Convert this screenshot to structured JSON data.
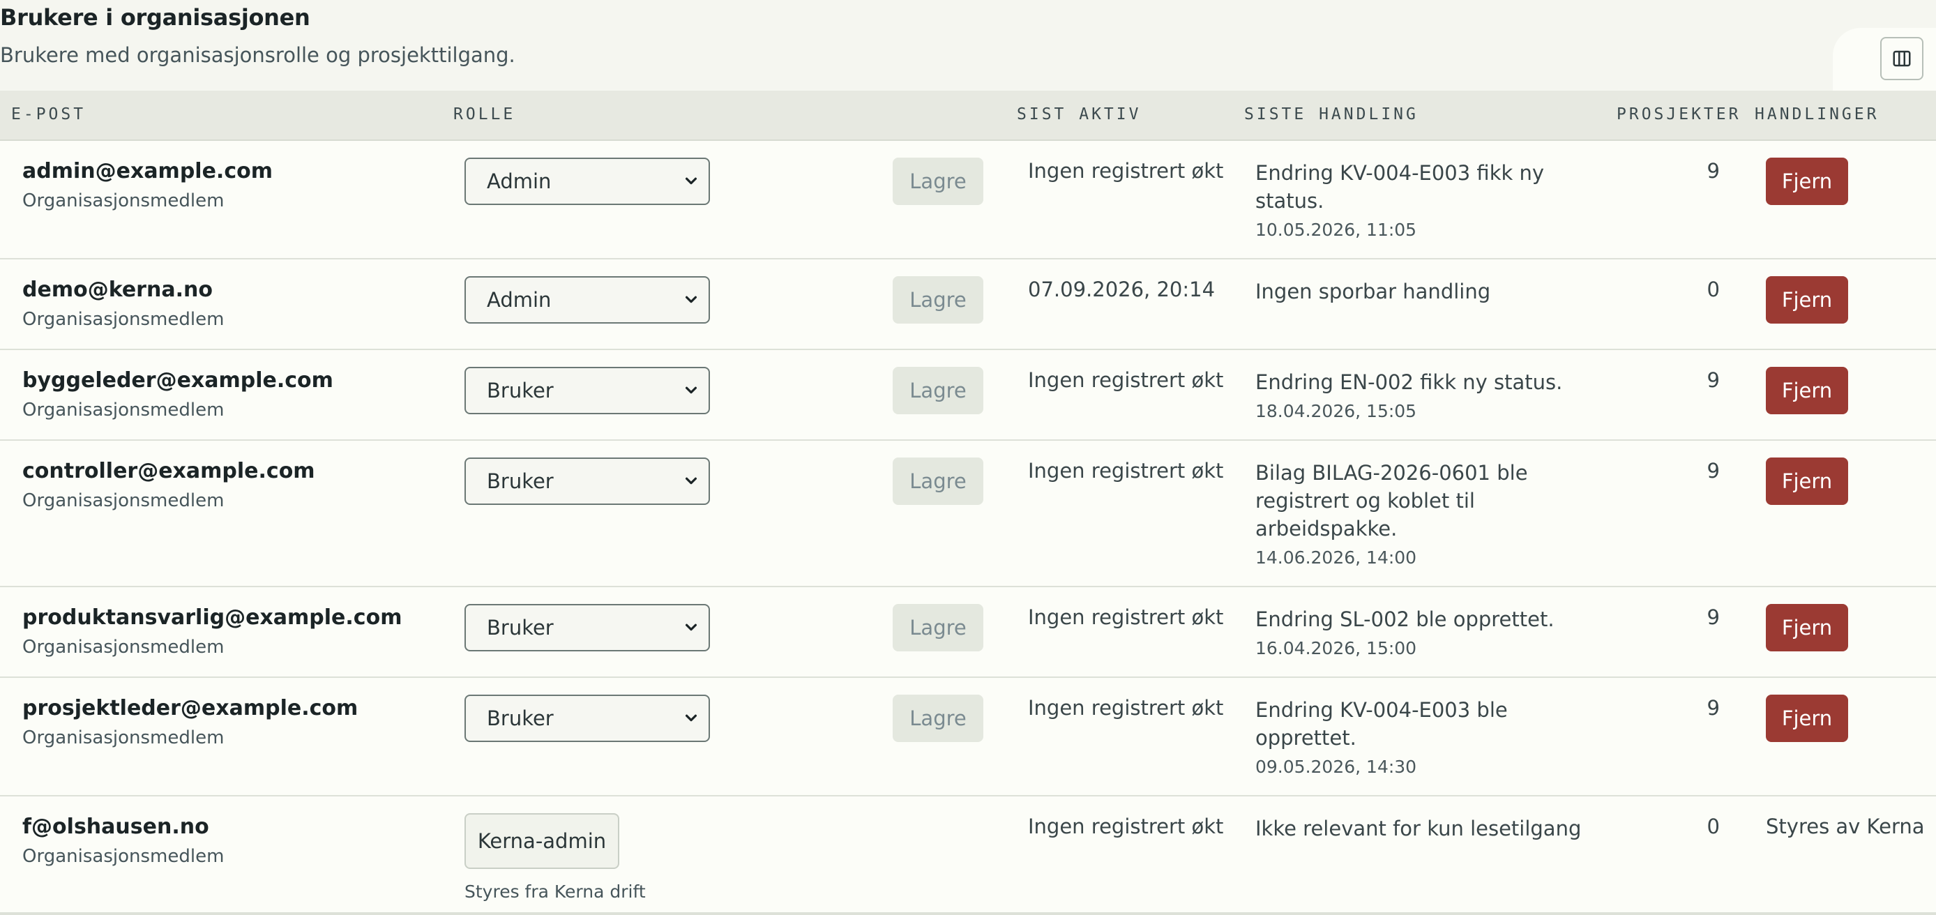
{
  "header": {
    "title": "Brukere i organisasjonen",
    "subtitle": "Brukere med organisasjonsrolle og prosjekttilgang.",
    "columns_icon": "columns-icon"
  },
  "columns": {
    "email": "E-POST",
    "role": "ROLLE",
    "last_active": "SIST AKTIV",
    "last_action": "SISTE HANDLING",
    "projects": "PROSJEKTER",
    "actions": "HANDLINGER"
  },
  "labels": {
    "save": "Lagre",
    "remove": "Fjern"
  },
  "rows": [
    {
      "email": "admin@example.com",
      "member": "Organisasjonsmedlem",
      "role": "Admin",
      "last_active": "Ingen registrert økt",
      "action": "Endring KV-004-E003 fikk ny status.",
      "action_date": "10.05.2026, 11:05",
      "projects": "9"
    },
    {
      "email": "demo@kerna.no",
      "member": "Organisasjonsmedlem",
      "role": "Admin",
      "last_active": "07.09.2026, 20:14",
      "action": "Ingen sporbar handling",
      "action_date": "",
      "projects": "0"
    },
    {
      "email": "byggeleder@example.com",
      "member": "Organisasjonsmedlem",
      "role": "Bruker",
      "last_active": "Ingen registrert økt",
      "action": "Endring EN-002 fikk ny status.",
      "action_date": "18.04.2026, 15:05",
      "projects": "9"
    },
    {
      "email": "controller@example.com",
      "member": "Organisasjonsmedlem",
      "role": "Bruker",
      "last_active": "Ingen registrert økt",
      "action": "Bilag BILAG-2026-0601 ble registrert og koblet til arbeidspakke.",
      "action_date": "14.06.2026, 14:00",
      "projects": "9"
    },
    {
      "email": "produktansvarlig@example.com",
      "member": "Organisasjonsmedlem",
      "role": "Bruker",
      "last_active": "Ingen registrert økt",
      "action": "Endring SL-002 ble opprettet.",
      "action_date": "16.04.2026, 15:00",
      "projects": "9"
    },
    {
      "email": "prosjektleder@example.com",
      "member": "Organisasjonsmedlem",
      "role": "Bruker",
      "last_active": "Ingen registrert økt",
      "action": "Endring KV-004-E003 ble opprettet.",
      "action_date": "09.05.2026, 14:30",
      "projects": "9"
    },
    {
      "email": "f@olshausen.no",
      "member": "Organisasjonsmedlem",
      "role_badge": "Kerna-admin",
      "role_note": "Styres fra Kerna drift",
      "last_active": "Ingen registrert økt",
      "action": "Ikke relevant for kun lesetilgang",
      "action_date": "",
      "projects": "0",
      "managed": "Styres av Kerna"
    }
  ],
  "colors": {
    "remove": "#9b3a33",
    "header_band": "#e7e9e1",
    "body": "#fcfdf8"
  }
}
